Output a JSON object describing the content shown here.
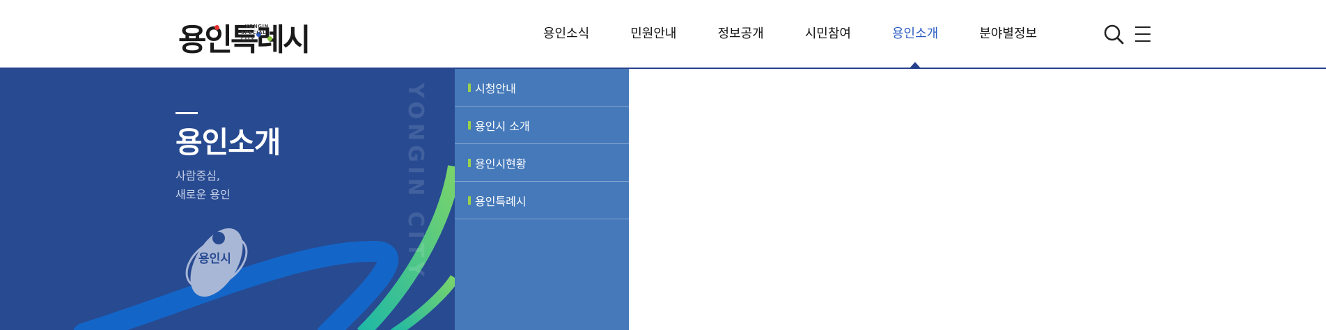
{
  "logo": {
    "text": "용인특례시",
    "sub_line1": "YONGIN",
    "sub_line2": "SPECIAL CITY",
    "dot_colors": [
      "#e5322d",
      "#2a5bc2",
      "#8cc63f"
    ]
  },
  "nav": {
    "items": [
      {
        "label": "용인소식"
      },
      {
        "label": "민원안내"
      },
      {
        "label": "정보공개"
      },
      {
        "label": "시민참여"
      },
      {
        "label": "용인소개",
        "active": true
      },
      {
        "label": "분야별정보"
      }
    ],
    "search_icon": "search-icon",
    "menu_icon": "hamburger-menu-icon"
  },
  "hero": {
    "title": "용인소개",
    "subtitle_line1": "사람중심,",
    "subtitle_line2": "새로운 용인",
    "vertical_text": "YONGIN CITY",
    "emblem_text": "용인시",
    "emblem_icon": "city-emblem-icon"
  },
  "submenu": {
    "items": [
      {
        "label": "시청안내"
      },
      {
        "label": "용인시 소개"
      },
      {
        "label": "용인시현황"
      },
      {
        "label": "용인특례시"
      }
    ]
  },
  "colors": {
    "accent": "#2a5bc2",
    "header_line": "#27418c",
    "hero_bg": "#274a91",
    "submenu_bg": "#4579ba",
    "submenu_marker": "#9bd24a"
  }
}
